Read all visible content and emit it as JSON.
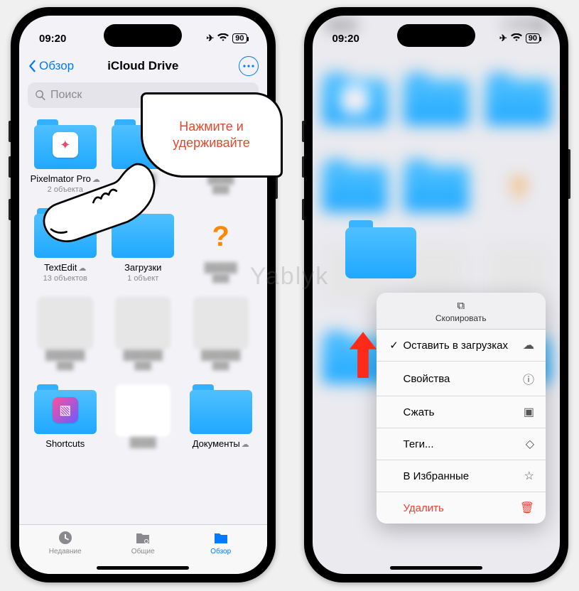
{
  "status": {
    "time": "09:20",
    "battery": "90"
  },
  "nav": {
    "back": "Обзор",
    "title": "iCloud Drive"
  },
  "search": {
    "placeholder": "Поиск"
  },
  "folders": {
    "pixelmator": {
      "name": "Pixelmator Pro",
      "sub": "2 объекта"
    },
    "textedit": {
      "name": "TextEdit",
      "sub": "13 объектов"
    },
    "downloads": {
      "name": "Загрузки",
      "sub": "1 объект"
    },
    "shortcuts": {
      "name": "Shortcuts"
    },
    "documents": {
      "name": "Документы"
    }
  },
  "tabs": {
    "recent": "Недавние",
    "shared": "Общие",
    "browse": "Обзор"
  },
  "callout": {
    "text": "Нажмите и удерживайте"
  },
  "context_menu": {
    "copy": "Скопировать",
    "keep_downloaded": "Оставить в загрузках",
    "info": "Свойства",
    "compress": "Сжать",
    "tags": "Теги...",
    "favorite": "В Избранные",
    "delete": "Удалить"
  },
  "watermark": "Yablyk"
}
